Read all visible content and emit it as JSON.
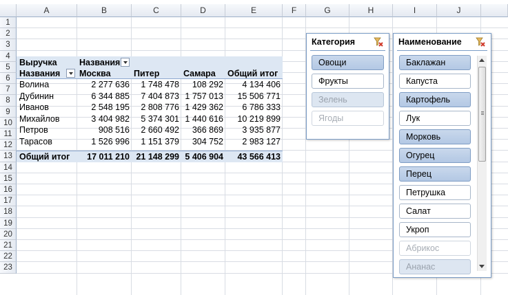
{
  "columns": [
    "A",
    "B",
    "C",
    "D",
    "E",
    "F",
    "G",
    "H",
    "I",
    "J",
    ""
  ],
  "rows": [
    "1",
    "2",
    "3",
    "4",
    "5",
    "6",
    "7",
    "8",
    "9",
    "10",
    "11",
    "12",
    "13",
    "14",
    "15",
    "16",
    "17",
    "18",
    "19",
    "20",
    "21",
    "22",
    "23"
  ],
  "pivot": {
    "values_label": "Выручка",
    "col_field_label": "Названия",
    "row_field_label": "Названия",
    "col_headers": [
      "Москва",
      "Питер",
      "Самара",
      "Общий итог"
    ],
    "data_rows": [
      {
        "name": "Волина",
        "values": [
          "2 277 636",
          "1 748 478",
          "108 292",
          "4 134 406"
        ]
      },
      {
        "name": "Дубинин",
        "values": [
          "6 344 885",
          "7 404 873",
          "1 757 013",
          "15 506 771"
        ]
      },
      {
        "name": "Иванов",
        "values": [
          "2 548 195",
          "2 808 776",
          "1 429 362",
          "6 786 333"
        ]
      },
      {
        "name": "Михайлов",
        "values": [
          "3 404 982",
          "5 374 301",
          "1 440 616",
          "10 219 899"
        ]
      },
      {
        "name": "Петров",
        "values": [
          "908 516",
          "2 660 492",
          "366 869",
          "3 935 877"
        ]
      },
      {
        "name": "Тарасов",
        "values": [
          "1 526 996",
          "1 151 379",
          "304 752",
          "2 983 127"
        ]
      }
    ],
    "total_row": {
      "name": "Общий итог",
      "values": [
        "17 011 210",
        "21 148 299",
        "5 406 904",
        "43 566 413"
      ]
    }
  },
  "slicer_category": {
    "title": "Категория",
    "items": [
      {
        "label": "Овощи",
        "state": "sel"
      },
      {
        "label": "Фрукты",
        "state": "nosel"
      },
      {
        "label": "Зелень",
        "state": "dimsel"
      },
      {
        "label": "Ягоды",
        "state": "dim"
      }
    ]
  },
  "slicer_name": {
    "title": "Наименование",
    "items": [
      {
        "label": "Баклажан",
        "state": "sel"
      },
      {
        "label": "Капуста",
        "state": "nosel"
      },
      {
        "label": "Картофель",
        "state": "sel"
      },
      {
        "label": "Лук",
        "state": "nosel"
      },
      {
        "label": "Морковь",
        "state": "sel"
      },
      {
        "label": "Огурец",
        "state": "sel"
      },
      {
        "label": "Перец",
        "state": "sel"
      },
      {
        "label": "Петрушка",
        "state": "nosel"
      },
      {
        "label": "Салат",
        "state": "nosel"
      },
      {
        "label": "Укроп",
        "state": "nosel"
      },
      {
        "label": "Абрикос",
        "state": "dim"
      },
      {
        "label": "Ананас",
        "state": "dimsel"
      }
    ]
  },
  "colors": {
    "accent": "#7a9cc6",
    "selected": "#b3c8e4",
    "header_band": "#dde7f3"
  },
  "icons": {
    "clear_filter": "clear-filter-icon",
    "dropdown": "dropdown-arrow-icon"
  }
}
